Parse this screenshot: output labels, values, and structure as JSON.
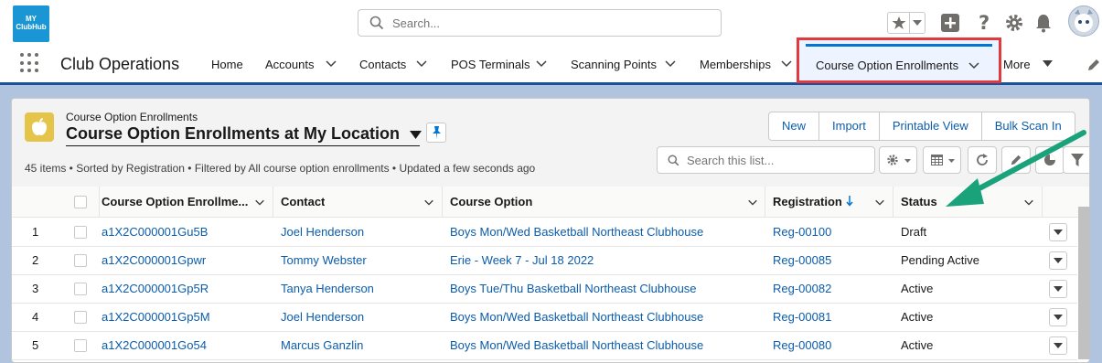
{
  "brand": {
    "logo_line1": "MY",
    "logo_line2": "ClubHub"
  },
  "search": {
    "placeholder": "Search..."
  },
  "nav": {
    "app_name": "Club Operations",
    "items": [
      {
        "label": "Home"
      },
      {
        "label": "Accounts"
      },
      {
        "label": "Contacts"
      },
      {
        "label": "POS Terminals"
      },
      {
        "label": "Scanning Points"
      },
      {
        "label": "Memberships"
      },
      {
        "label": "Course Option Enrollments"
      },
      {
        "label": "More"
      }
    ]
  },
  "list": {
    "object_label": "Course Option Enrollments",
    "view_name": "Course Option Enrollments at My Location",
    "meta": "45 items • Sorted by Registration • Filtered by All course option enrollments • Updated a few seconds ago",
    "search_placeholder": "Search this list...",
    "actions": [
      "New",
      "Import",
      "Printable View",
      "Bulk Scan In"
    ]
  },
  "table": {
    "columns": [
      "Course Option Enrollme...",
      "Contact",
      "Course Option",
      "Registration",
      "Status"
    ],
    "rows": [
      {
        "num": "1",
        "id": "a1X2C000001Gu5B",
        "contact": "Joel Henderson",
        "course": "Boys Mon/Wed Basketball Northeast Clubhouse",
        "registration": "Reg-00100",
        "status": "Draft"
      },
      {
        "num": "2",
        "id": "a1X2C000001Gpwr",
        "contact": "Tommy Webster",
        "course": "Erie - Week 7 - Jul 18 2022",
        "registration": "Reg-00085",
        "status": "Pending Active"
      },
      {
        "num": "3",
        "id": "a1X2C000001Gp5R",
        "contact": "Tanya Henderson",
        "course": "Boys Tue/Thu Basketball Northeast Clubhouse",
        "registration": "Reg-00082",
        "status": "Active"
      },
      {
        "num": "4",
        "id": "a1X2C000001Gp5M",
        "contact": "Joel Henderson",
        "course": "Boys Mon/Wed Basketball Northeast Clubhouse",
        "registration": "Reg-00081",
        "status": "Active"
      },
      {
        "num": "5",
        "id": "a1X2C000001Go54",
        "contact": "Marcus Ganzlin",
        "course": "Boys Mon/Wed Basketball Northeast Clubhouse",
        "registration": "Reg-00080",
        "status": "Active"
      }
    ]
  },
  "colors": {
    "link": "#0b5cab",
    "highlight_box": "#e0393e",
    "arrow": "#1aa37a",
    "brand": "#1b96d4"
  }
}
